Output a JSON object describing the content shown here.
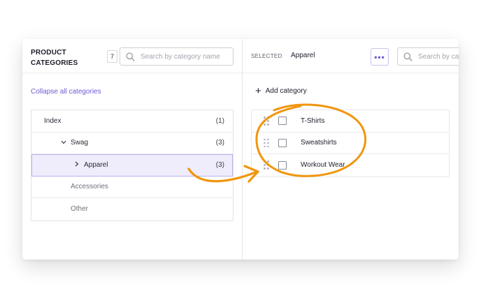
{
  "left_panel": {
    "title": "PRODUCT CATEGORIES",
    "count": "7",
    "search_placeholder": "Search by category name",
    "collapse_link": "Collapse all categories",
    "tree": [
      {
        "label": "Index",
        "count": "(1)",
        "chevron": "",
        "selected": false
      },
      {
        "label": "Swag",
        "count": "(3)",
        "chevron": "⌄",
        "selected": false
      },
      {
        "label": "Apparel",
        "count": "(3)",
        "chevron": "›",
        "selected": true
      },
      {
        "label": "Accessories",
        "count": "",
        "chevron": "",
        "selected": false
      },
      {
        "label": "Other",
        "count": "",
        "chevron": "",
        "selected": false
      }
    ]
  },
  "right_panel": {
    "selected_label": "SELECTED",
    "selected_value": "Apparel",
    "more_button": "•••",
    "search_placeholder": "Search by category name",
    "add_category": "Add category",
    "subcategories": [
      {
        "label": "T-Shirts"
      },
      {
        "label": "Sweatshirts"
      },
      {
        "label": "Workout Wear"
      }
    ]
  },
  "colors": {
    "accent": "#6b5bd6",
    "selected_bg": "#efedfb",
    "annotation": "#f0960e"
  }
}
